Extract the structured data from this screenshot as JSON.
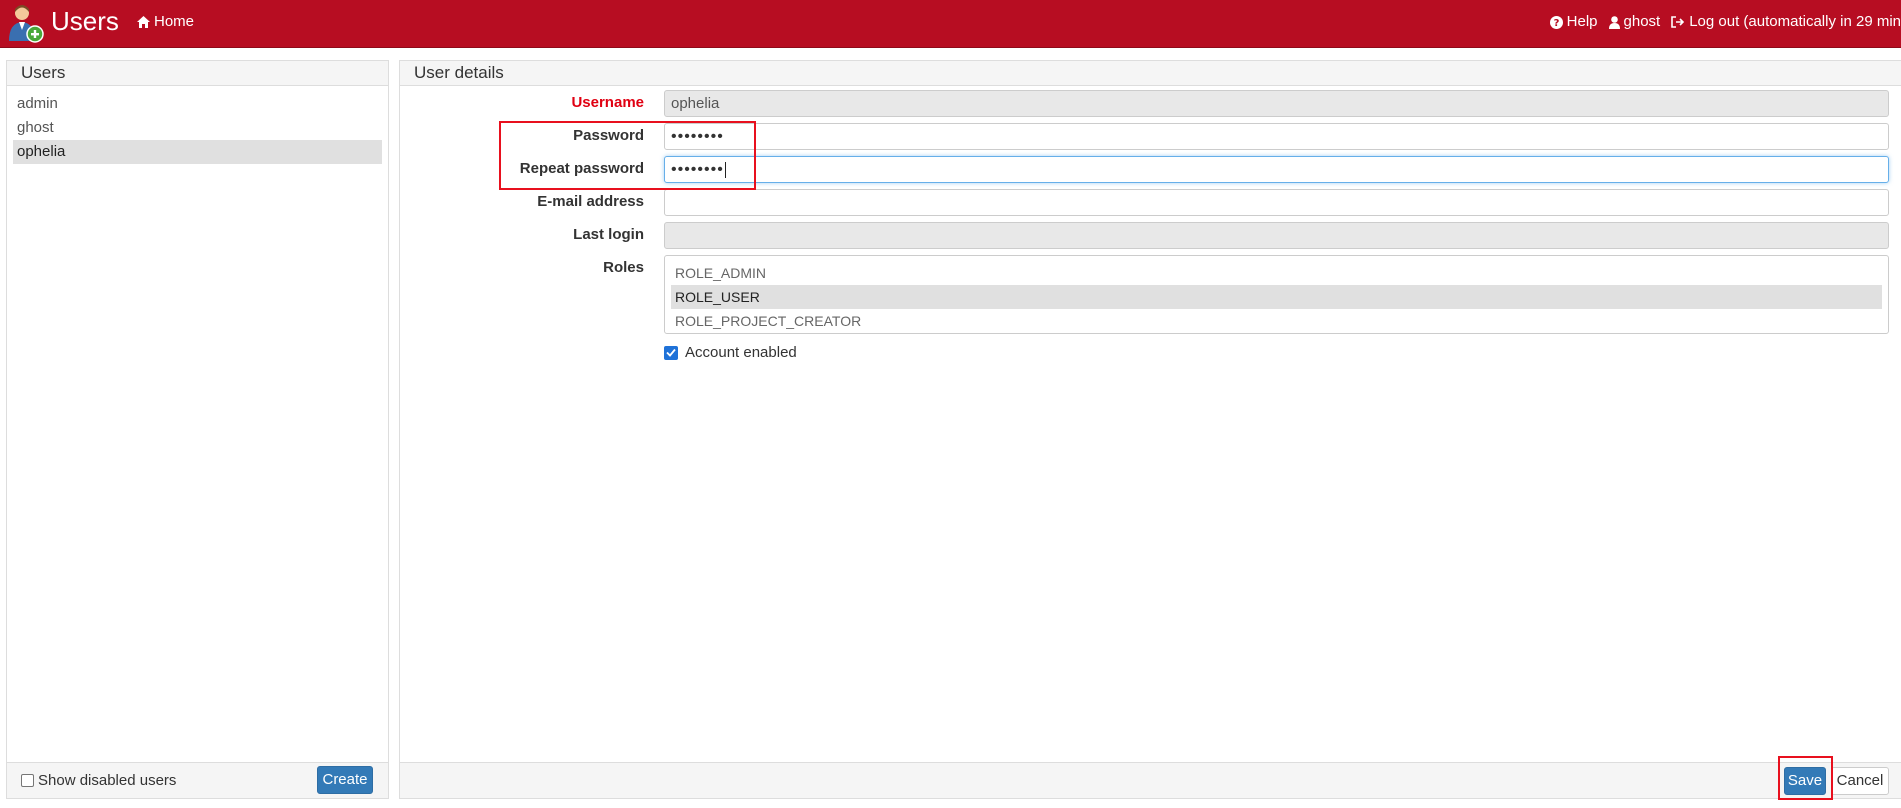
{
  "header": {
    "title": "Users",
    "logo_icon": "user-add-icon",
    "home_label": "Home",
    "help_label": "Help",
    "user_label": "ghost",
    "logout_label": "Log out (automatically in 29 min"
  },
  "users_panel": {
    "title": "Users",
    "users": [
      "admin",
      "ghost",
      "ophelia"
    ],
    "selected_user": "ophelia",
    "show_disabled_label": "Show disabled users",
    "show_disabled_checked": false,
    "create_label": "Create"
  },
  "details_panel": {
    "title": "User details",
    "username_label": "Username",
    "username_value": "ophelia",
    "password_label": "Password",
    "password_value": "••••••••",
    "repeat_password_label": "Repeat password",
    "repeat_password_value": "••••••••",
    "email_label": "E-mail address",
    "email_value": "",
    "last_login_label": "Last login",
    "last_login_value": "",
    "roles_label": "Roles",
    "roles": [
      "ROLE_ADMIN",
      "ROLE_USER",
      "ROLE_PROJECT_CREATOR"
    ],
    "selected_role": "ROLE_USER",
    "account_enabled_label": "Account enabled",
    "account_enabled_checked": true,
    "save_label": "Save",
    "cancel_label": "Cancel"
  },
  "colors": {
    "navbar": "#b70d22",
    "required_label": "#e00012",
    "primary_button": "#337ab7",
    "highlight_box": "#e8101e"
  }
}
